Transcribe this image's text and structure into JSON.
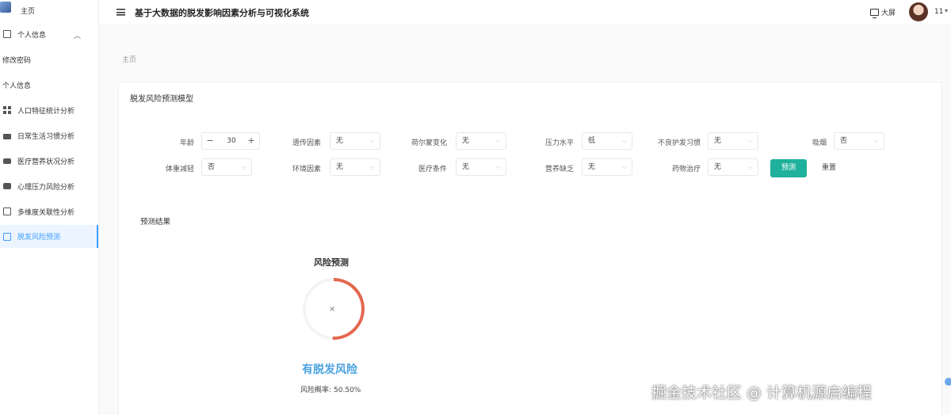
{
  "header": {
    "title": "基于大数据的脱发影响因素分析与可视化系统",
    "bigscreen_label": "大屏",
    "username": "11"
  },
  "sidebar": {
    "items": [
      {
        "label": "主页",
        "icon": "home-icon"
      },
      {
        "label": "个人信息",
        "icon": "user-card-icon"
      },
      {
        "label": "修改密码",
        "icon": ""
      },
      {
        "label": "个人信息",
        "icon": ""
      },
      {
        "label": "人口特征统计分析",
        "icon": "grid-icon"
      },
      {
        "label": "日常生活习惯分析",
        "icon": "briefcase-icon"
      },
      {
        "label": "医疗营养状况分析",
        "icon": "chat-icon"
      },
      {
        "label": "心理压力风险分析",
        "icon": "chat-icon"
      },
      {
        "label": "多维度关联性分析",
        "icon": "copy-icon"
      },
      {
        "label": "脱发风险预测",
        "icon": "card-icon"
      }
    ],
    "active_index": 9
  },
  "breadcrumb": "主页",
  "form": {
    "card_title": "脱发风险预测模型",
    "age": {
      "label": "年龄",
      "value": "30",
      "minus": "−",
      "plus": "+"
    },
    "genetics": {
      "label": "遗传因素",
      "value": "无"
    },
    "hormones": {
      "label": "荷尔蒙变化",
      "value": "无"
    },
    "stress": {
      "label": "压力水平",
      "value": "低"
    },
    "hair_care": {
      "label": "不良护发习惯",
      "value": "无"
    },
    "smoking": {
      "label": "吸烟",
      "value": "否"
    },
    "weight_loss": {
      "label": "体重减轻",
      "value": "否"
    },
    "environment": {
      "label": "环境因素",
      "value": "无"
    },
    "medical": {
      "label": "医疗条件",
      "value": "无"
    },
    "nutrition": {
      "label": "营养缺乏",
      "value": "无"
    },
    "medication": {
      "label": "药物治疗",
      "value": "无"
    },
    "predict_label": "预测",
    "reset_label": "重置",
    "chevron": "⌵"
  },
  "result": {
    "section_title": "预测结果",
    "gauge_title": "风险预测",
    "gauge_center": "×",
    "risk_label": "有脱发风险",
    "prob_label": "风险概率:",
    "probability_percent": 50.5,
    "prob_text": "50.50%",
    "gauge_color": "#e4674f"
  },
  "colors": {
    "primary": "#409eff",
    "predict_button": "#1fb19c",
    "risk_text": "#4aa3df"
  },
  "watermark": "掘金技术社区 @ 计算机源启编程"
}
